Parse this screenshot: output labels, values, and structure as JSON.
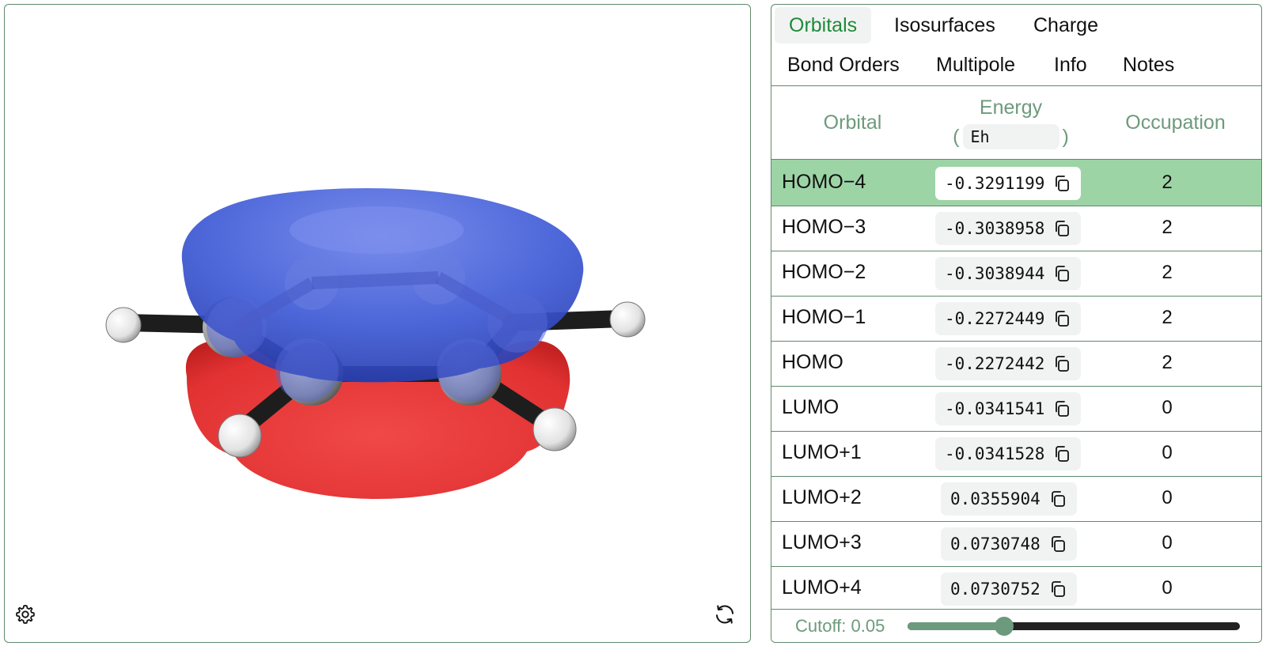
{
  "tabs": [
    {
      "label": "Orbitals",
      "active": true
    },
    {
      "label": "Isosurfaces",
      "active": false
    },
    {
      "label": "Charge",
      "active": false
    },
    {
      "label": "Bond Orders",
      "active": false
    },
    {
      "label": "Multipole",
      "active": false
    },
    {
      "label": "Info",
      "active": false
    },
    {
      "label": "Notes",
      "active": false
    }
  ],
  "table": {
    "headers": {
      "orbital": "Orbital",
      "energy": "Energy",
      "energy_open": "(",
      "energy_close": ")",
      "occupation": "Occupation"
    },
    "energy_unit": "Eh",
    "selected_index": 0,
    "rows": [
      {
        "orbital": "HOMO−4",
        "energy": "-0.3291199",
        "occupation": "2"
      },
      {
        "orbital": "HOMO−3",
        "energy": "-0.3038958",
        "occupation": "2"
      },
      {
        "orbital": "HOMO−2",
        "energy": "-0.3038944",
        "occupation": "2"
      },
      {
        "orbital": "HOMO−1",
        "energy": "-0.2272449",
        "occupation": "2"
      },
      {
        "orbital": "HOMO",
        "energy": "-0.2272442",
        "occupation": "2"
      },
      {
        "orbital": "LUMO",
        "energy": "-0.0341541",
        "occupation": "0"
      },
      {
        "orbital": "LUMO+1",
        "energy": "-0.0341528",
        "occupation": "0"
      },
      {
        "orbital": "LUMO+2",
        "energy": "0.0355904",
        "occupation": "0"
      },
      {
        "orbital": "LUMO+3",
        "energy": "0.0730748",
        "occupation": "0"
      },
      {
        "orbital": "LUMO+4",
        "energy": "0.0730752",
        "occupation": "0"
      }
    ]
  },
  "cutoff": {
    "label": "Cutoff: 0.05",
    "fraction": 0.29
  },
  "viewer": {
    "settings_icon": "gear-icon",
    "reset_icon": "refresh-icon",
    "positive_lobe_color": "#3f5bd6",
    "negative_lobe_color": "#e23232"
  },
  "colors": {
    "accent": "#1f8a3a",
    "border": "#5e8a6a",
    "header_text": "#6d9a7c",
    "selected_row": "#9dd4a6"
  }
}
